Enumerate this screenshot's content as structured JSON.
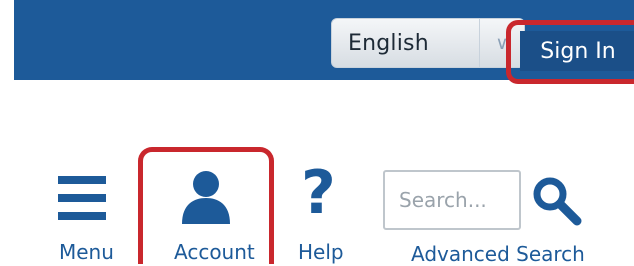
{
  "header": {
    "language": {
      "selected": "English",
      "arrow_glyph": "∨"
    },
    "sign_in_label": "Sign In"
  },
  "nav": {
    "menu_label": "Menu",
    "account_label": "Account",
    "help_label": "Help",
    "help_glyph": "?",
    "search_placeholder": "Search...",
    "advanced_search_label": "Advanced Search"
  },
  "colors": {
    "header_bg": "#1d5a99",
    "sign_in_bg": "#1b4f88",
    "accent_blue": "#1d5a99",
    "highlight_red": "#c9272d"
  }
}
